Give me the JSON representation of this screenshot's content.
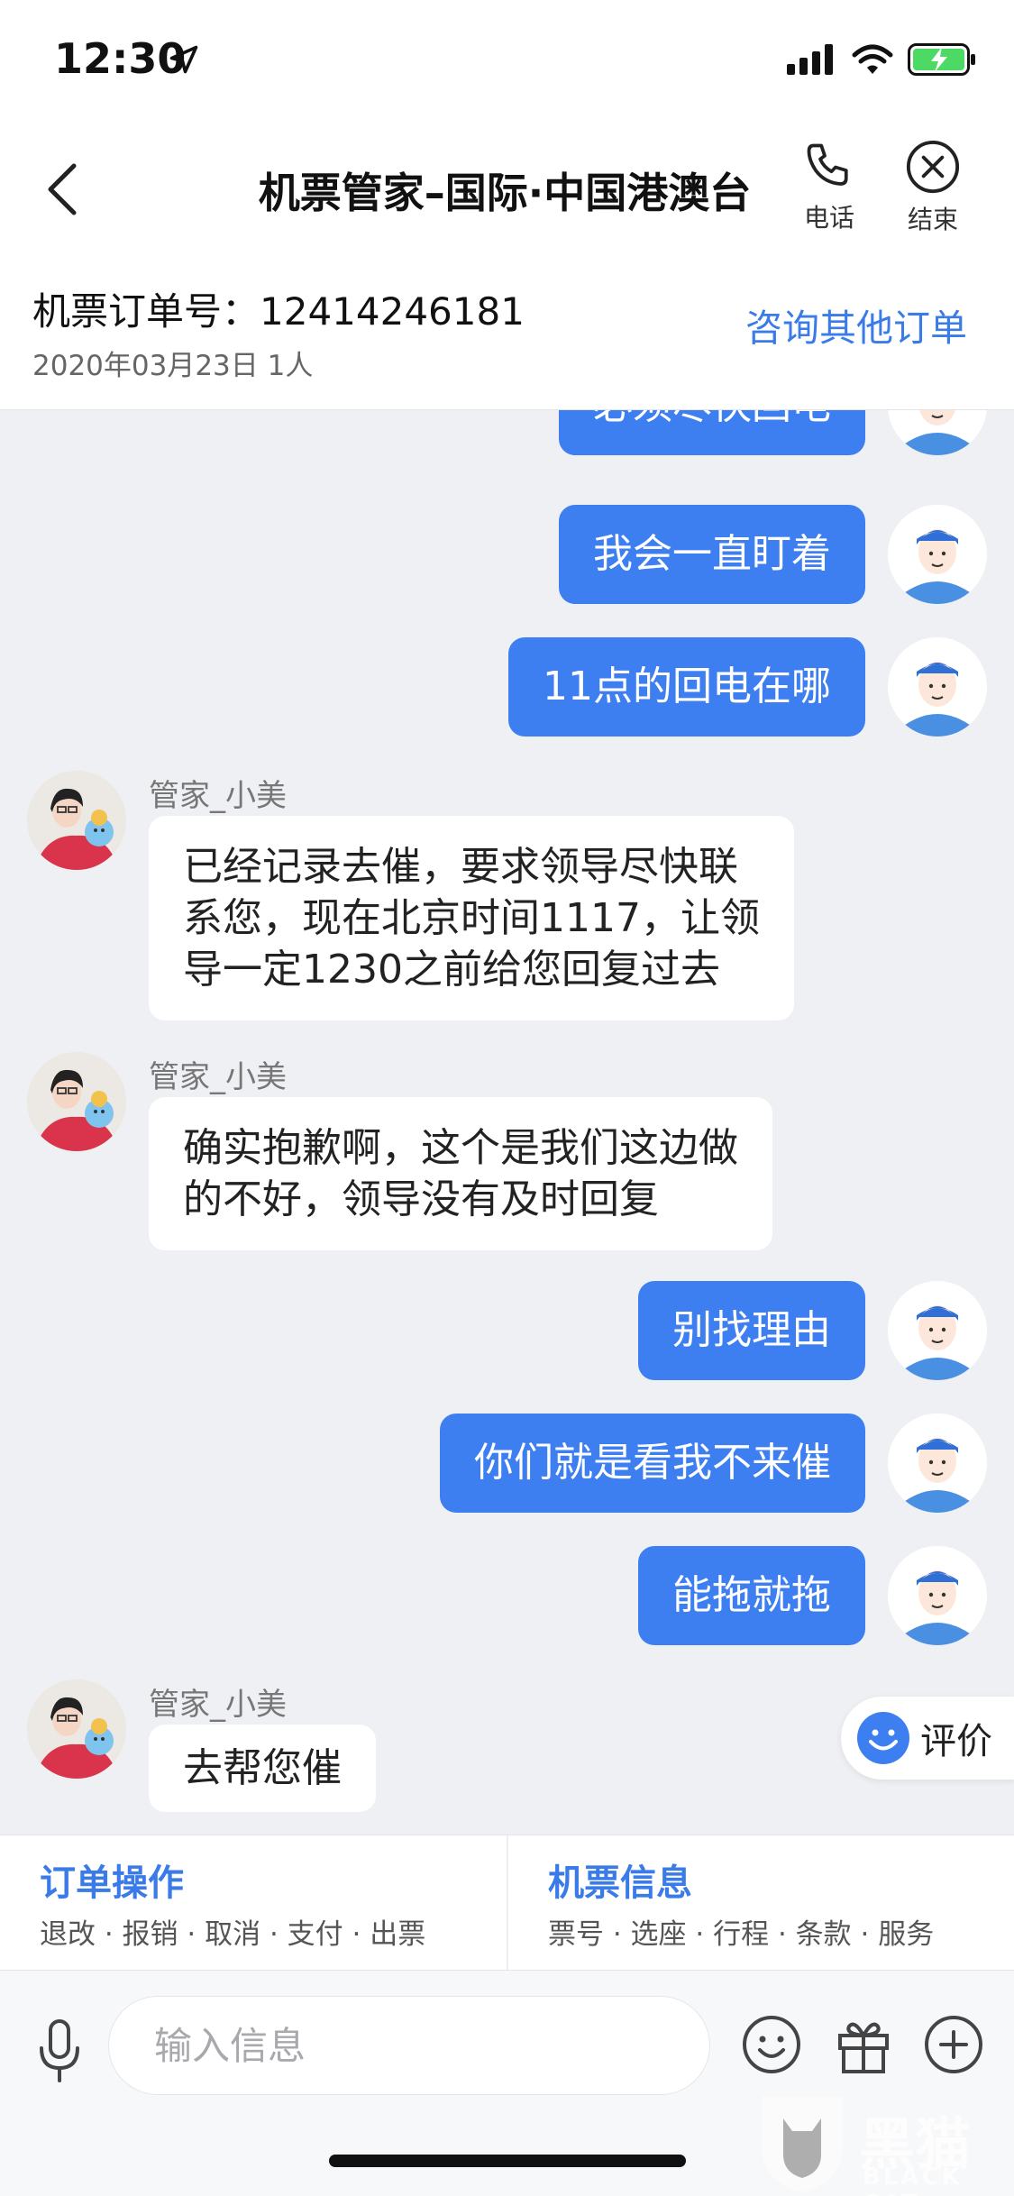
{
  "status": {
    "time": "12:30",
    "battery_color": "#4cd964"
  },
  "nav": {
    "title": "机票管家–国际·中国港澳台",
    "phone_label": "电话",
    "end_label": "结束"
  },
  "order": {
    "number_text": "机票订单号：12414246181",
    "meta": "2020年03月23日 1人",
    "other_orders": "咨询其他订单"
  },
  "messages": {
    "u0": "必须尽快回电",
    "u1": "我会一直盯着",
    "u2": "11点的回电在哪",
    "a1_name": "管家_小美",
    "a1_line1": "已经记录去催，要求领导尽快联",
    "a1_line2": "系您，现在北京时间1117，让领",
    "a1_line3": "导一定1230之前给您回复过去",
    "a2_name": "管家_小美",
    "a2_line1": "确实抱歉啊，这个是我们这边做",
    "a2_line2": "的不好，领导没有及时回复",
    "u3": "别找理由",
    "u4": "你们就是看我不来催",
    "u5": "能拖就拖",
    "a3_name": "管家_小美",
    "a3_line1": "去帮您催"
  },
  "rate": {
    "label": "评价"
  },
  "actions": {
    "order_ops_title": "订单操作",
    "order_ops_sub": "退改 · 报销 · 取消 · 支付 · 出票",
    "ticket_info_title": "机票信息",
    "ticket_info_sub": "票号 · 选座 · 行程 · 条款 · 服务"
  },
  "input": {
    "placeholder": "输入信息"
  },
  "watermark": {
    "text": "黑猫",
    "sub": "BLACK CAT"
  },
  "colors": {
    "accent": "#3a7be8",
    "user_bubble": "#3d7ff1"
  }
}
